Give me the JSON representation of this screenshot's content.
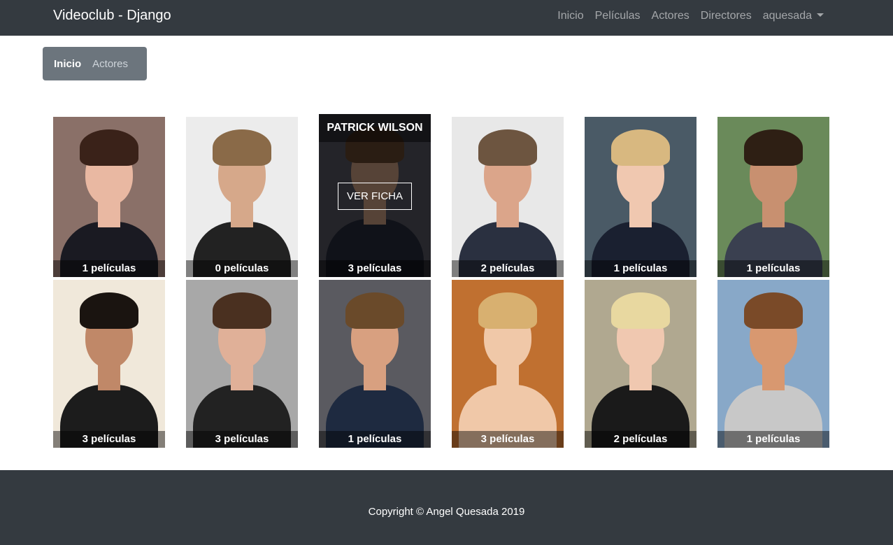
{
  "navbar": {
    "brand": "Videoclub - Django",
    "links": [
      "Inicio",
      "Películas",
      "Actores",
      "Directores"
    ],
    "user": "aquesada"
  },
  "breadcrumb": {
    "active": "Inicio",
    "items": [
      "Actores"
    ]
  },
  "actors": [
    {
      "caption": "1 películas",
      "bg": "#8a7068",
      "skin": "#e9b8a2",
      "hair": "#3a2219",
      "clothes": "#1a1a22"
    },
    {
      "caption": "0 películas",
      "bg": "#ececec",
      "skin": "#d6a88a",
      "hair": "#8a6a48",
      "clothes": "#222222"
    },
    {
      "caption": "3 películas",
      "name": "PATRICK WILSON",
      "button": "VER FICHA",
      "bg": "#5a5a66",
      "skin": "#d8a88a",
      "hair": "#6a4a30",
      "clothes": "#2a2f3f"
    },
    {
      "caption": "2 películas",
      "bg": "#e8e8e8",
      "skin": "#dba58a",
      "hair": "#6d5540",
      "clothes": "#2a3040"
    },
    {
      "caption": "1 películas",
      "bg": "#4a5a66",
      "skin": "#f0c8b0",
      "hair": "#d8b880",
      "clothes": "#1a2030"
    },
    {
      "caption": "1 películas",
      "bg": "#6a8a5a",
      "skin": "#c89070",
      "hair": "#2e1f14",
      "clothes": "#3a4050"
    },
    {
      "caption": "3 películas",
      "bg": "#f0e8da",
      "skin": "#c08868",
      "hair": "#1a1410",
      "clothes": "#1c1c1c"
    },
    {
      "caption": "3 películas",
      "bg": "#a8a8a8",
      "skin": "#e0b098",
      "hair": "#4a3020",
      "clothes": "#222222"
    },
    {
      "caption": "1 películas",
      "bg": "#5a5a60",
      "skin": "#d8a080",
      "hair": "#6a4a2a",
      "clothes": "#1e2a40"
    },
    {
      "caption": "3 películas",
      "bg": "#c07030",
      "skin": "#f0c8a8",
      "hair": "#d8b070",
      "clothes": "#f0c8a8"
    },
    {
      "caption": "2 películas",
      "bg": "#b0a890",
      "skin": "#f0c8b0",
      "hair": "#e8d8a0",
      "clothes": "#1a1a1a"
    },
    {
      "caption": "1 películas",
      "bg": "#88a8c8",
      "skin": "#d89870",
      "hair": "#7a4a28",
      "clothes": "#c8c8c8"
    }
  ],
  "footer": {
    "text": "Copyright © Angel Quesada 2019"
  }
}
